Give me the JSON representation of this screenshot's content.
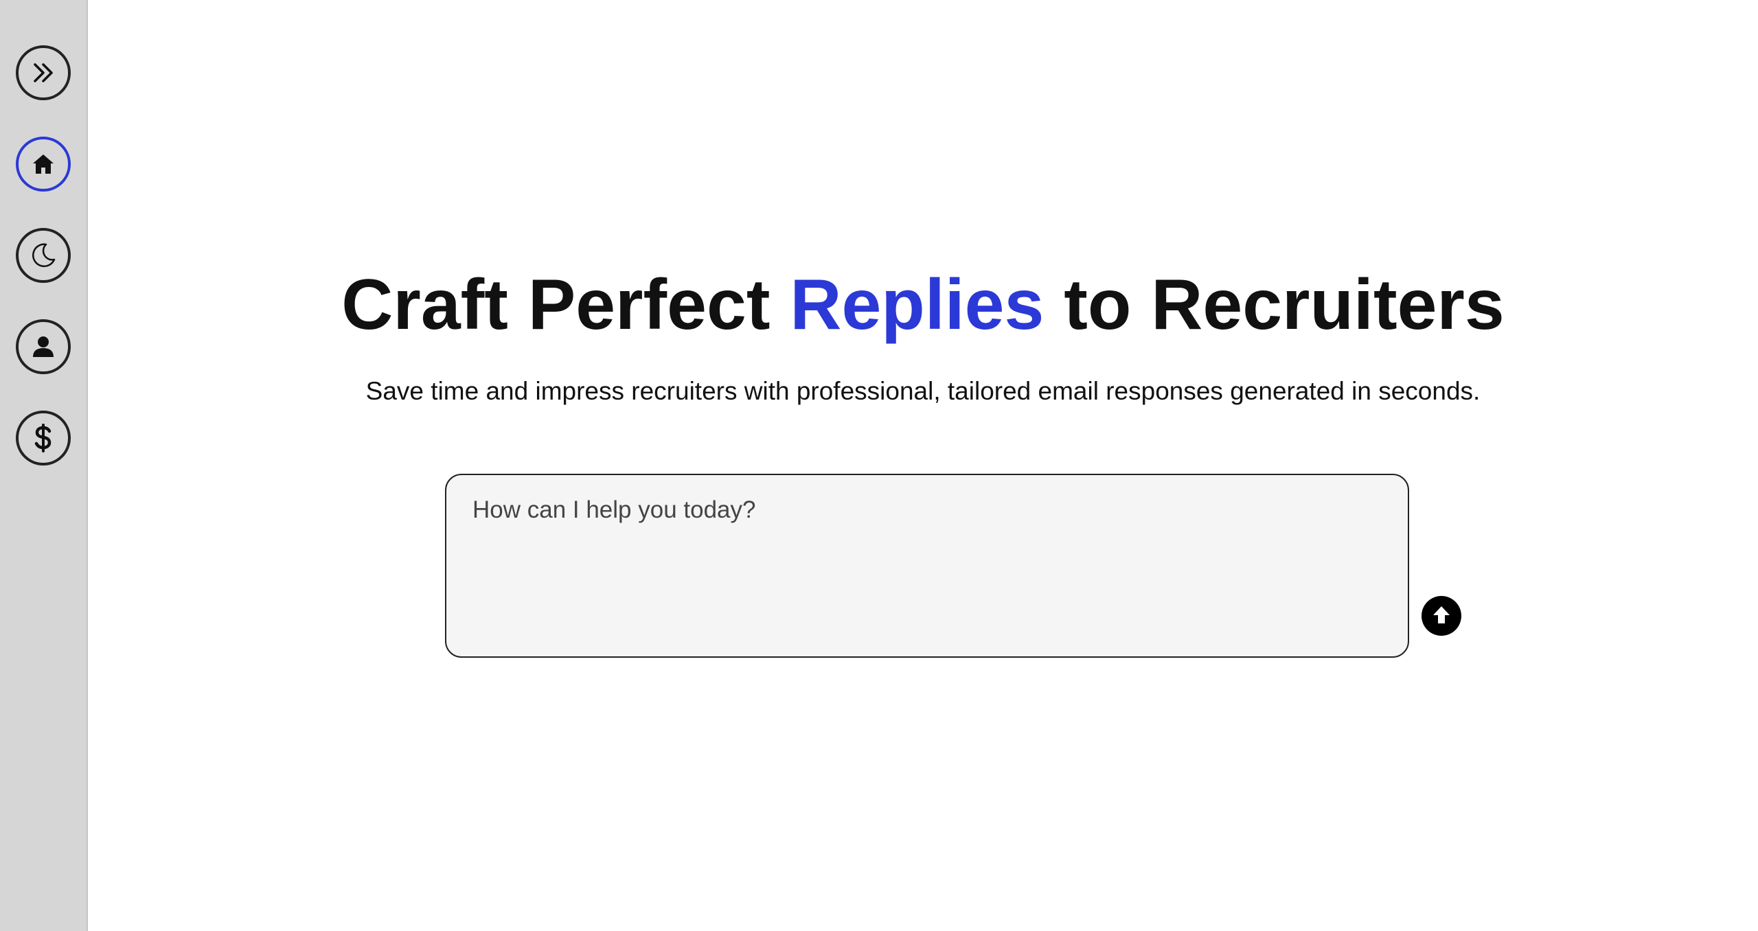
{
  "sidebar": {
    "items": [
      {
        "id": "expand",
        "icon": "double-chevron-right-icon",
        "active": false
      },
      {
        "id": "home",
        "icon": "home-icon",
        "active": true
      },
      {
        "id": "theme",
        "icon": "moon-icon",
        "active": false
      },
      {
        "id": "profile",
        "icon": "user-icon",
        "active": false
      },
      {
        "id": "pricing",
        "icon": "dollar-icon",
        "active": false
      }
    ]
  },
  "hero": {
    "title_before": "Craft Perfect ",
    "title_accent": "Replies",
    "title_after": " to Recruiters",
    "subtitle": "Save time and impress recruiters with professional, tailored email responses generated in seconds."
  },
  "prompt": {
    "placeholder": "How can I help you today?",
    "value": ""
  },
  "colors": {
    "accent": "#2b39d6",
    "sidebar_bg": "#d6d6d6",
    "input_bg": "#f5f5f5"
  }
}
